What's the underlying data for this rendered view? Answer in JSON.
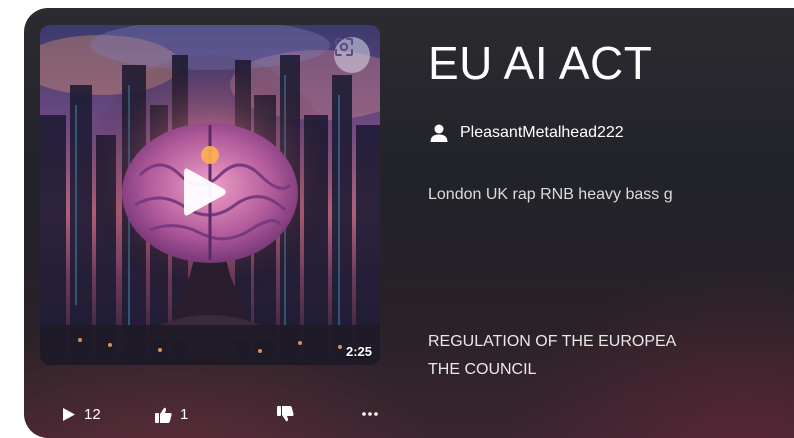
{
  "song": {
    "title": "EU AI ACT",
    "author": "PleasantMetalhead222",
    "tags": "London UK rap RNB heavy bass g",
    "lyrics_line1": "REGULATION OF THE EUROPEA",
    "lyrics_line2": "THE COUNCIL",
    "duration": "2:25"
  },
  "stats": {
    "plays": "12",
    "likes": "1",
    "more_label": "..."
  },
  "icons": {
    "scan": "scan-icon",
    "play": "play-icon",
    "user": "user-icon",
    "plays": "play-count-icon",
    "like": "thumbs-up-icon",
    "dislike": "thumbs-down-icon",
    "more": "more-icon"
  },
  "colors": {
    "card_bg": "#26252b",
    "text_primary": "#ffffff",
    "text_secondary": "#dcdcdc"
  }
}
